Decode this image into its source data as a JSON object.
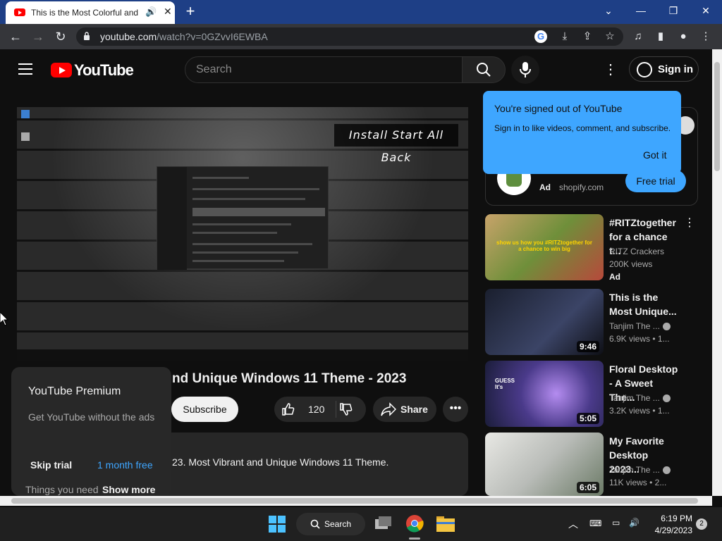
{
  "browser": {
    "tab_title": "This is the Most Colorful and",
    "url_host": "youtube.com",
    "url_path": "/watch?v=0GZvvI6EWBA"
  },
  "youtube": {
    "logo_text": "YouTube",
    "search_placeholder": "Search",
    "sign_in_label": "Sign in",
    "tooltip": {
      "heading": "You're signed out of YouTube",
      "body": "Sign in to like videos, comment, and subscribe.",
      "button": "Got it"
    },
    "player": {
      "overlay_text": "Install Start All Back"
    },
    "video": {
      "title": "nd Unique Windows 11 Theme - 2023",
      "subscribe_label": "Subscribe",
      "like_count": "120",
      "share_label": "Share",
      "description": "23. Most Vibrant and Unique Windows 11 Theme.",
      "things_text": "Things you need",
      "show_more": "Show more"
    },
    "premium_card": {
      "title": "YouTube Premium",
      "subtitle": "Get YouTube without the ads",
      "skip_label": "Skip trial",
      "offer_label": "1 month free"
    },
    "ad_card": {
      "ad_label": "Ad",
      "domain": "shopify.com",
      "cta_label": "Free trial"
    },
    "recommendations": [
      {
        "title": "#RITZtogether for a chance t...",
        "channel": "RITZ Crackers",
        "meta": "200K views",
        "badge": "Ad",
        "duration": "",
        "thumb_text": "show us how you #RITZtogether for a chance to win big"
      },
      {
        "title": "This is the Most Unique...",
        "channel": "Tanjim The ...",
        "meta": "6.9K views • 1...",
        "badge": "",
        "duration": "9:46"
      },
      {
        "title": "Floral Desktop - A Sweet The...",
        "channel": "Tanjim The ...",
        "meta": "3.2K views • 1...",
        "badge": "",
        "duration": "5:05",
        "thumb_text": "GUESS It's"
      },
      {
        "title": "My Favorite Desktop 2023...",
        "channel": "Tanjim The ...",
        "meta": "11K views • 2...",
        "badge": "",
        "duration": "6:05"
      }
    ]
  },
  "taskbar": {
    "search_label": "Search",
    "time": "6:19 PM",
    "date": "4/29/2023",
    "notification_count": "2"
  },
  "colors": {
    "accent": "#3ea6ff",
    "brand_red": "#ff0000",
    "titlebar": "#1e3f86"
  }
}
